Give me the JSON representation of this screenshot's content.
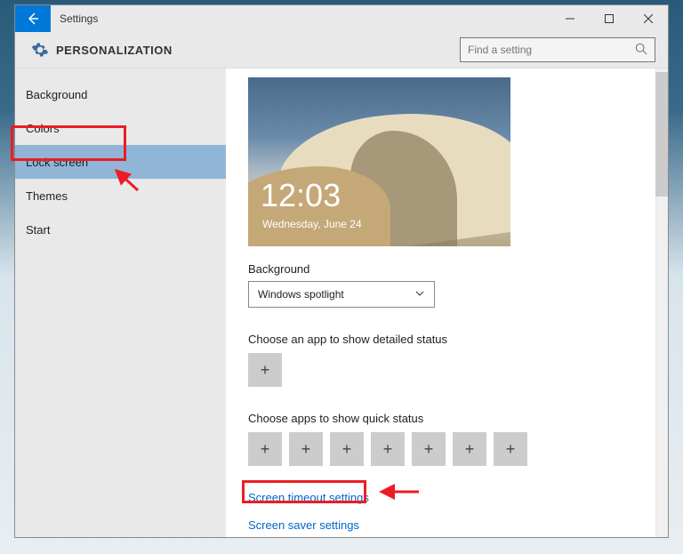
{
  "window": {
    "title": "Settings"
  },
  "header": {
    "title": "PERSONALIZATION",
    "search_placeholder": "Find a setting"
  },
  "sidebar": {
    "items": [
      {
        "label": "Background"
      },
      {
        "label": "Colors"
      },
      {
        "label": "Lock screen"
      },
      {
        "label": "Themes"
      },
      {
        "label": "Start"
      }
    ],
    "selected_index": 2
  },
  "lockscreen": {
    "preview_time": "12:03",
    "preview_date": "Wednesday, June 24",
    "background_label": "Background",
    "background_value": "Windows spotlight",
    "detailed_label": "Choose an app to show detailed status",
    "quick_label": "Choose apps to show quick status",
    "link_timeout": "Screen timeout settings",
    "link_saver": "Screen saver settings"
  }
}
